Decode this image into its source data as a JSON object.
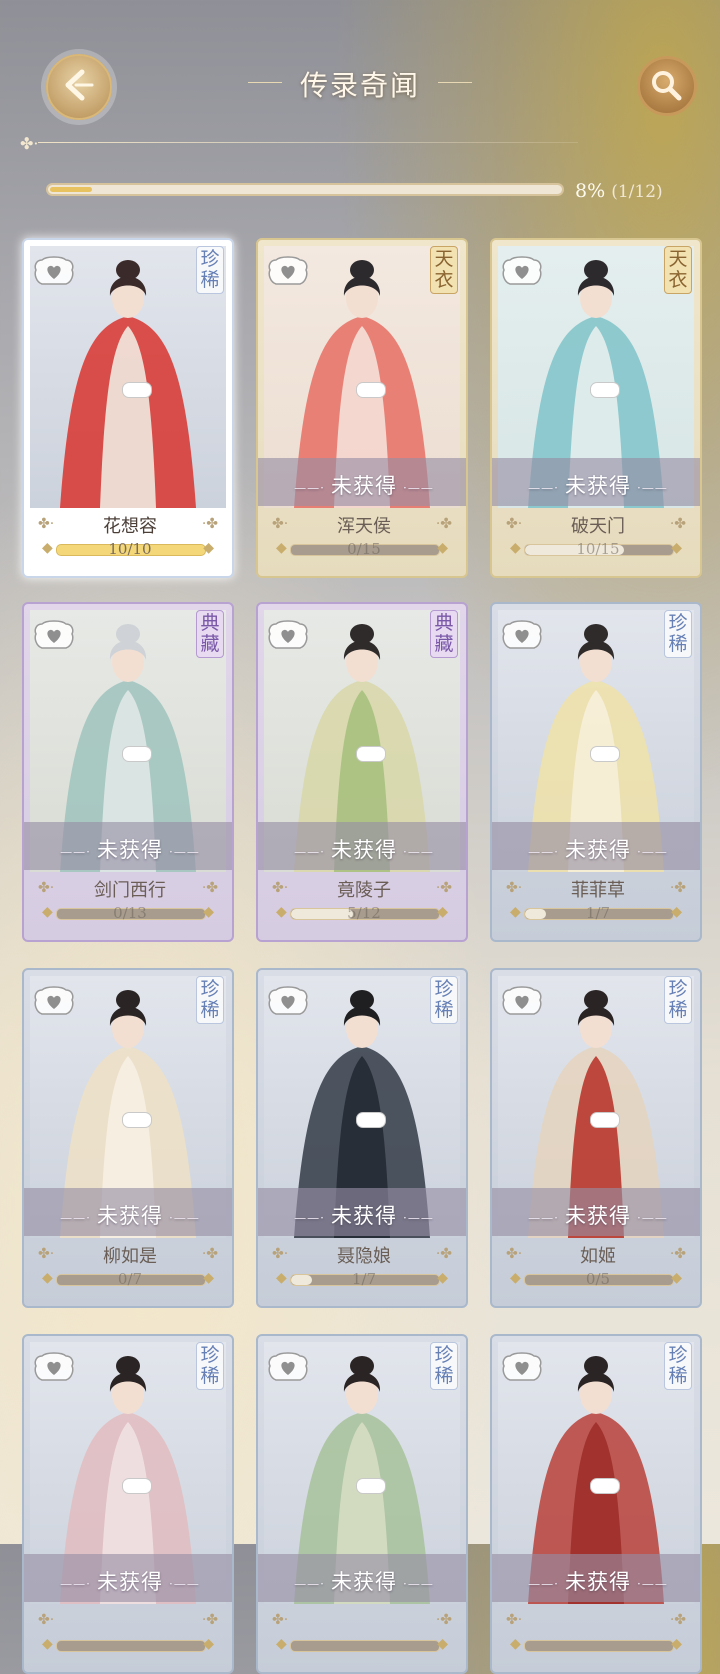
{
  "header": {
    "title": "传录奇闻",
    "progress_percent": "8%",
    "progress_count": "(1/12)",
    "progress_fraction": 0.083
  },
  "lock_label": "未获得",
  "cards": [
    {
      "name": "花想容",
      "count": "10/10",
      "badge": "珍稀",
      "type": "rare",
      "owned": true,
      "fraction": 1.0
    },
    {
      "name": "浑天侯",
      "count": "0/15",
      "badge": "天衣",
      "type": "tianyi",
      "owned": false,
      "fraction": 0.0
    },
    {
      "name": "破天门",
      "count": "10/15",
      "badge": "天衣",
      "type": "tianyi",
      "owned": false,
      "fraction": 0.67
    },
    {
      "name": "剑门西行",
      "count": "0/13",
      "badge": "典藏",
      "type": "diancang",
      "owned": false,
      "fraction": 0.0
    },
    {
      "name": "竟陵子",
      "count": "5/12",
      "badge": "典藏",
      "type": "diancang",
      "owned": false,
      "fraction": 0.42
    },
    {
      "name": "菲菲草",
      "count": "1/7",
      "badge": "珍稀",
      "type": "rare",
      "owned": false,
      "fraction": 0.14
    },
    {
      "name": "柳如是",
      "count": "0/7",
      "badge": "珍稀",
      "type": "rare",
      "owned": false,
      "fraction": 0.0
    },
    {
      "name": "聂隐娘",
      "count": "1/7",
      "badge": "珍稀",
      "type": "rare",
      "owned": false,
      "fraction": 0.14
    },
    {
      "name": "如姬",
      "count": "0/5",
      "badge": "珍稀",
      "type": "rare",
      "owned": false,
      "fraction": 0.0
    },
    {
      "name": "",
      "count": "",
      "badge": "珍稀",
      "type": "rare",
      "owned": false,
      "fraction": 0.0
    },
    {
      "name": "",
      "count": "",
      "badge": "珍稀",
      "type": "rare",
      "owned": false,
      "fraction": 0.0
    },
    {
      "name": "",
      "count": "",
      "badge": "珍稀",
      "type": "rare",
      "owned": false,
      "fraction": 0.0
    }
  ],
  "colors": {
    "gold": "#e8c25e",
    "rare_badge": "#6680b6",
    "tianyi_badge": "#8a6430",
    "diancang_badge": "#7a58a8"
  }
}
